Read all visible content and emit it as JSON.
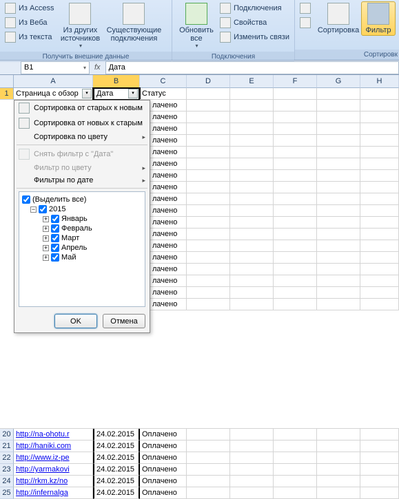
{
  "ribbon": {
    "group_connections": {
      "caption": "Получить внешние данные",
      "from_access": "Из Access",
      "from_web": "Из Веба",
      "from_text": "Из текста",
      "other_sources": "Из других\nисточников",
      "existing": "Существующие\nподключения"
    },
    "group_conn2": {
      "caption": "Подключения",
      "refresh": "Обновить\nвсе",
      "links": "Подключения",
      "props": "Свойства",
      "edit_links": "Изменить связи"
    },
    "group_sort": {
      "caption": "Сортировк",
      "sort": "Сортировка",
      "filter": "Фильтр"
    }
  },
  "namebox": {
    "ref": "B1",
    "fx": "fx",
    "formula": "Дата"
  },
  "columns": [
    "A",
    "B",
    "C",
    "D",
    "E",
    "F",
    "G",
    "H"
  ],
  "headers": {
    "A": "Страница с обзор",
    "B": "Дата",
    "C": "Статус"
  },
  "visible_rows": [
    {
      "n": 20,
      "A": "http://na-ohotu.r",
      "B": "24.02.2015",
      "C": "Оплачено"
    },
    {
      "n": 21,
      "A": "http://haniki.com",
      "B": "24.02.2015",
      "C": "Оплачено"
    },
    {
      "n": 22,
      "A": "http://www.iz-pe",
      "B": "24.02.2015",
      "C": "Оплачено"
    },
    {
      "n": 23,
      "A": "http://yarmakovi",
      "B": "24.02.2015",
      "C": "Оплачено"
    },
    {
      "n": 24,
      "A": "http://rkm.kz/no",
      "B": "24.02.2015",
      "C": "Оплачено"
    },
    {
      "n": 25,
      "A": "http://infernalga",
      "B": "24.02.2015",
      "C": "Оплачено"
    }
  ],
  "filter_panel": {
    "sort_asc": "Сортировка от старых к новым",
    "sort_desc": "Сортировка от новых к старым",
    "sort_color": "Сортировка по цвету",
    "clear": "Снять фильтр с \"Дата\"",
    "filter_color": "Фильтр по цвету",
    "filter_date": "Фильтры по дате",
    "select_all": "(Выделить все)",
    "year": "2015",
    "months": [
      "Январь",
      "Февраль",
      "Март",
      "Апрель",
      "Май"
    ],
    "ok": "OK",
    "cancel": "Отмена",
    "hidden_status": "лачено"
  }
}
